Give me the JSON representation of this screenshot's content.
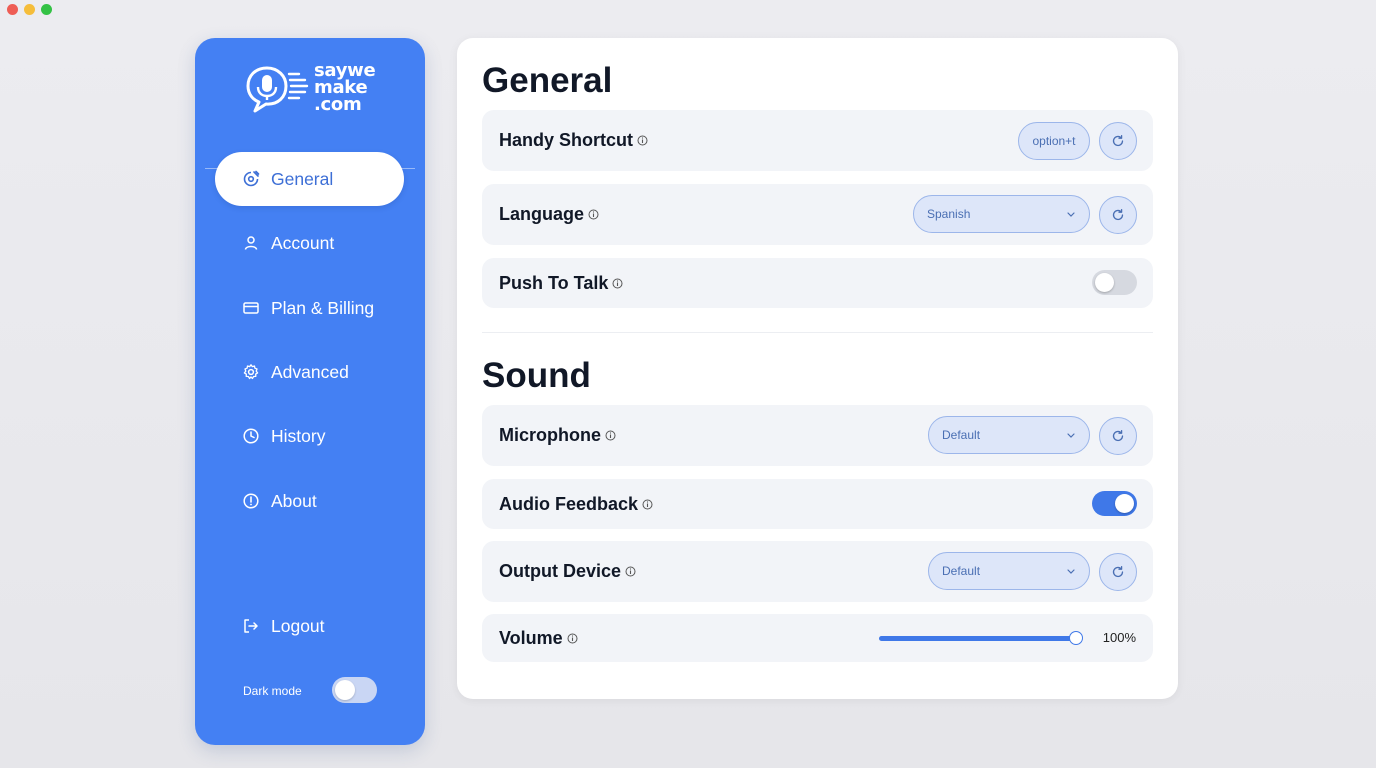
{
  "sidebar": {
    "logo_lines": [
      "saywe",
      "make",
      ".com"
    ],
    "items": [
      {
        "label": "General",
        "icon": "general-settings-icon"
      },
      {
        "label": "Account",
        "icon": "user-icon"
      },
      {
        "label": "Plan & Billing",
        "icon": "credit-card-icon"
      },
      {
        "label": "Advanced",
        "icon": "gear-icon"
      },
      {
        "label": "History",
        "icon": "clock-icon"
      },
      {
        "label": "About",
        "icon": "info-icon"
      }
    ],
    "active_item": "General",
    "logout_label": "Logout",
    "dark_mode_label": "Dark mode",
    "dark_mode_enabled": false,
    "accent_color": "#4480f3"
  },
  "general": {
    "title": "General",
    "handy_shortcut": {
      "label": "Handy Shortcut",
      "value": "option+t"
    },
    "language": {
      "label": "Language",
      "value": "Spanish"
    },
    "push_to_talk": {
      "label": "Push To Talk",
      "enabled": false
    }
  },
  "sound": {
    "title": "Sound",
    "microphone": {
      "label": "Microphone",
      "value": "Default"
    },
    "audio_feedback": {
      "label": "Audio Feedback",
      "enabled": true
    },
    "output_device": {
      "label": "Output Device",
      "value": "Default"
    },
    "volume": {
      "label": "Volume",
      "value": 1.0,
      "display": "100%"
    }
  }
}
